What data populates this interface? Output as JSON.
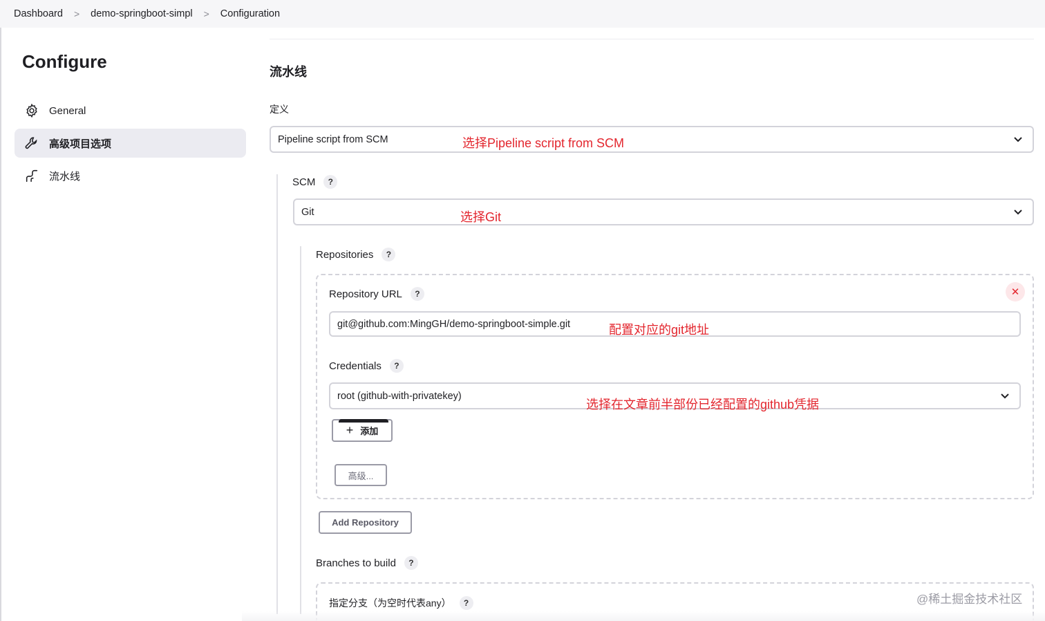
{
  "breadcrumb": {
    "items": [
      "Dashboard",
      "demo-springboot-simpl",
      "Configuration"
    ],
    "separator": ">"
  },
  "sidebar": {
    "title": "Configure",
    "items": [
      {
        "label": "General",
        "icon": "gear-icon",
        "active": false
      },
      {
        "label": "高级项目选项",
        "icon": "wrench-icon",
        "active": true
      },
      {
        "label": "流水线",
        "icon": "pipeline-icon",
        "active": false
      }
    ]
  },
  "pipeline": {
    "section_title": "流水线",
    "definition_label": "定义",
    "definition_value": "Pipeline script from SCM",
    "definition_annotation": "选择Pipeline script from SCM",
    "scm_label": "SCM",
    "scm_value": "Git",
    "scm_annotation": "选择Git",
    "repositories_label": "Repositories",
    "repo_url_label": "Repository URL",
    "repo_url_value": "git@github.com:MingGH/demo-springboot-simple.git",
    "repo_url_annotation": "配置对应的git地址",
    "credentials_label": "Credentials",
    "credentials_value": "root (github-with-privatekey)",
    "credentials_annotation": "选择在文章前半部份已经配置的github凭据",
    "add_button": "添加",
    "advanced_button": "高级...",
    "add_repository_button": "Add Repository",
    "branches_label": "Branches to build",
    "branch_specifier_label": "指定分支（为空时代表any）",
    "help_symbol": "?",
    "remove_symbol": "✕",
    "plus_symbol": "+"
  },
  "watermark": "@稀土掘金技术社区",
  "colors": {
    "annotation": "#e3262e",
    "active_bg": "#ebebf1",
    "border": "#d3d3da"
  }
}
